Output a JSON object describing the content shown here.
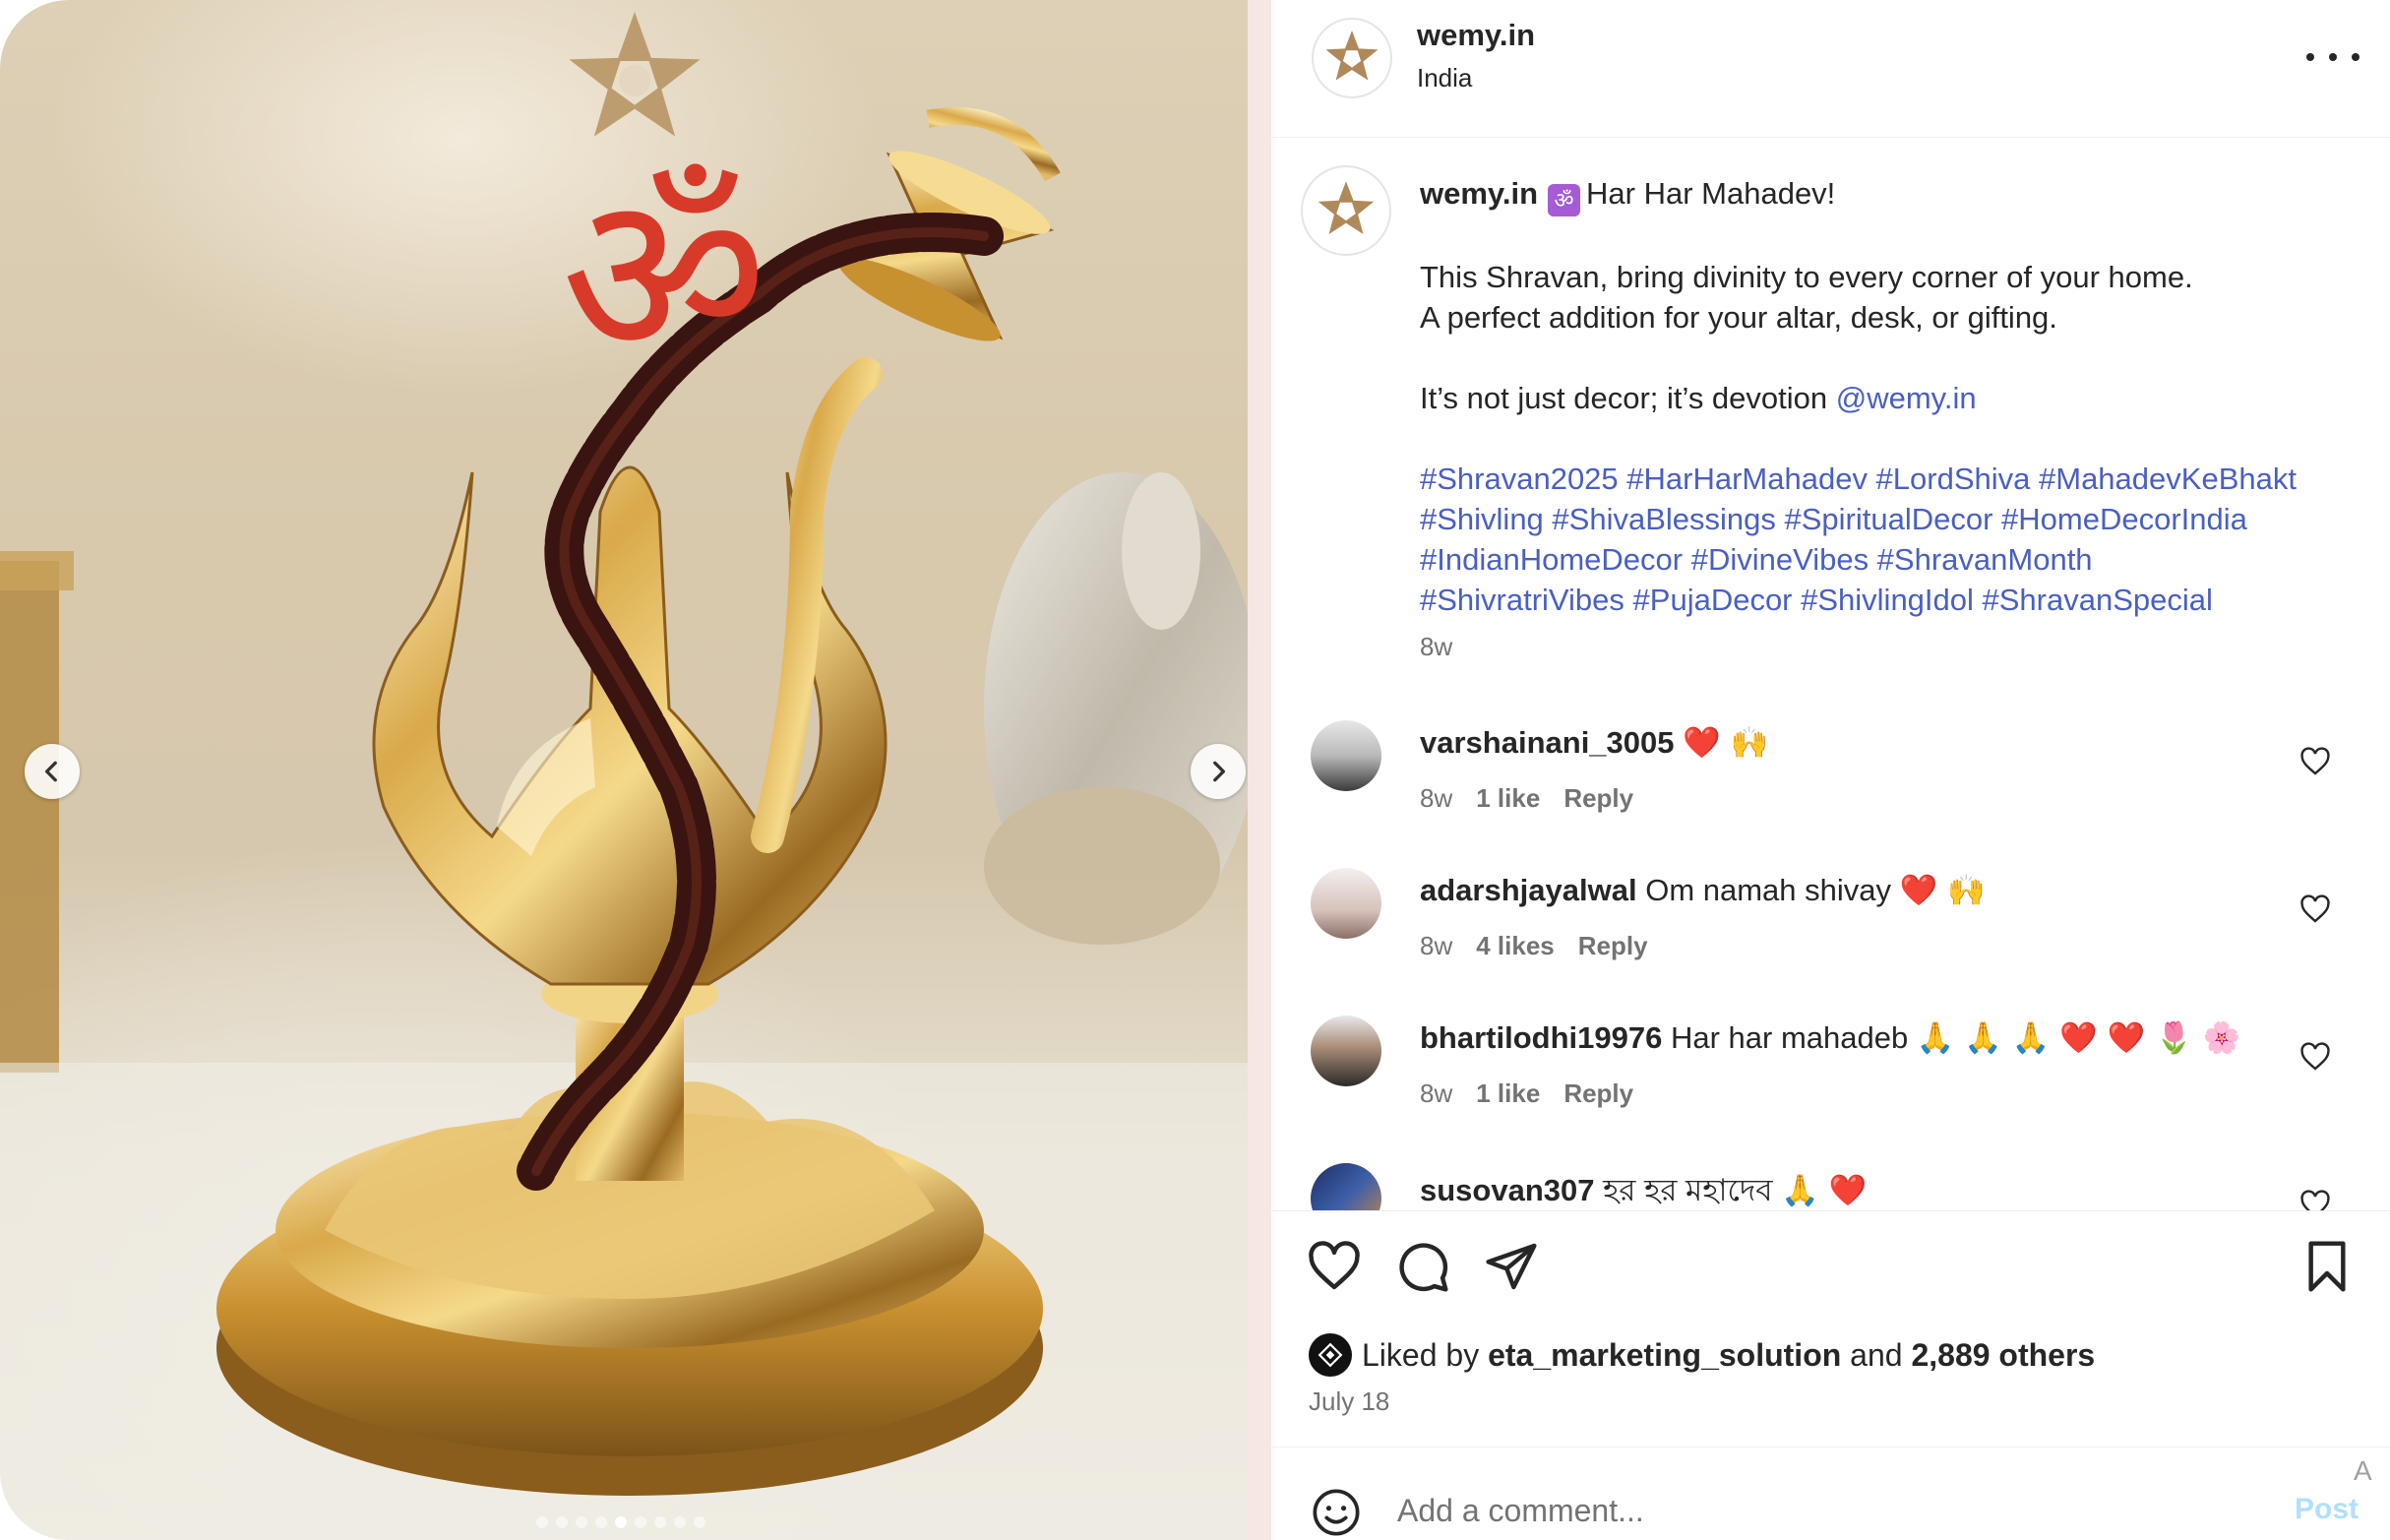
{
  "header": {
    "username": "wemy.in",
    "location": "India"
  },
  "caption": {
    "username": "wemy.in",
    "emoji": "ॐ",
    "title": "Har Har Mahadev!",
    "line1": "This Shravan, bring divinity to every corner of your home.",
    "line2": "A perfect addition for your altar, desk, or gifting.",
    "line3": "It’s not just decor; it’s devotion",
    "mention": "@wemy.in",
    "hashtags_line1": "#Shravan2025 #HarHarMahadev #LordShiva #MahadevKeBhakt",
    "hashtags_line2": "#Shivling #ShivaBlessings #SpiritualDecor #HomeDecorIndia",
    "hashtags_line3": "#IndianHomeDecor #DivineVibes #ShravanMonth",
    "hashtags_line4": "#ShivratriVibes #PujaDecor #ShivlingIdol #ShravanSpecial",
    "time": "8w"
  },
  "comments": [
    {
      "user": "varshainani_3005",
      "text": "",
      "emoji": "❤️ 🙌",
      "time": "8w",
      "likes": "1 like",
      "reply": "Reply"
    },
    {
      "user": "adarshjayalwal",
      "text": "Om namah shivay",
      "emoji": "❤️ 🙌",
      "time": "8w",
      "likes": "4 likes",
      "reply": "Reply"
    },
    {
      "user": "bhartilodhi19976",
      "text": "Har har mahadeb",
      "emoji": "🙏 🙏 🙏 ❤️ ❤️ 🌷 🌸",
      "time": "8w",
      "likes": "1 like",
      "reply": "Reply"
    },
    {
      "user": "susovan307",
      "text": "হর হর মহাদেব",
      "emoji": "🙏 ❤️",
      "time": "",
      "likes": "",
      "reply": ""
    }
  ],
  "likes": {
    "prefix": "Liked by",
    "user": "eta_marketing_solution",
    "and": "and",
    "others": "2,889 others"
  },
  "date": "July 18",
  "add_comment": {
    "placeholder": "Add a comment...",
    "post_label": "Post",
    "corner_letter": "A"
  },
  "carousel": {
    "total_slides": 9,
    "active_slide": 5
  },
  "colors": {
    "link": "#4a5fc1",
    "post_disabled": "#b2dffc",
    "muted": "#737373",
    "om_badge": "#a55bd6"
  }
}
